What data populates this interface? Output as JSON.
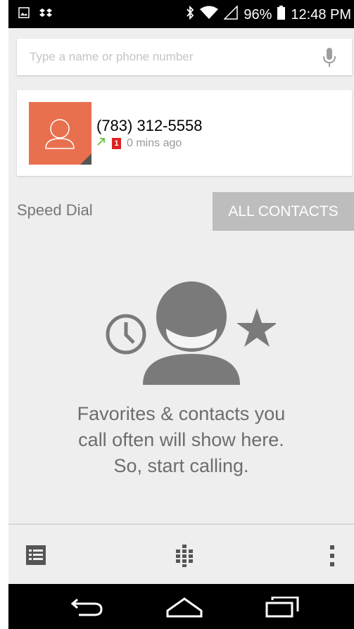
{
  "status_bar": {
    "battery": "96%",
    "time": "12:48 PM",
    "icons": [
      "image-icon",
      "dropbox-icon",
      "bluetooth-icon",
      "wifi-icon",
      "signal-icon",
      "battery-icon"
    ]
  },
  "search": {
    "placeholder": "Type a name or phone number",
    "value": ""
  },
  "recent_call": {
    "number": "(783) 312-5558",
    "count": "1",
    "time_ago": "0 mins ago",
    "call_type": "outgoing",
    "photo_color": "#e8704f"
  },
  "speed_dial": {
    "label": "Speed Dial",
    "all_contacts_label": "ALL CONTACTS"
  },
  "empty_state": {
    "line1": "Favorites & contacts you",
    "line2": "call often will show here.",
    "line3": "So, start calling."
  },
  "action_bar": {
    "icons": [
      "call-log-icon",
      "dialpad-icon",
      "overflow-menu-icon"
    ]
  },
  "nav_bar": {
    "icons": [
      "back-icon",
      "home-icon",
      "recents-icon"
    ]
  },
  "colors": {
    "accent": "#e8704f",
    "tab_gray": "#bdbdbd",
    "background": "#eeeeee"
  }
}
